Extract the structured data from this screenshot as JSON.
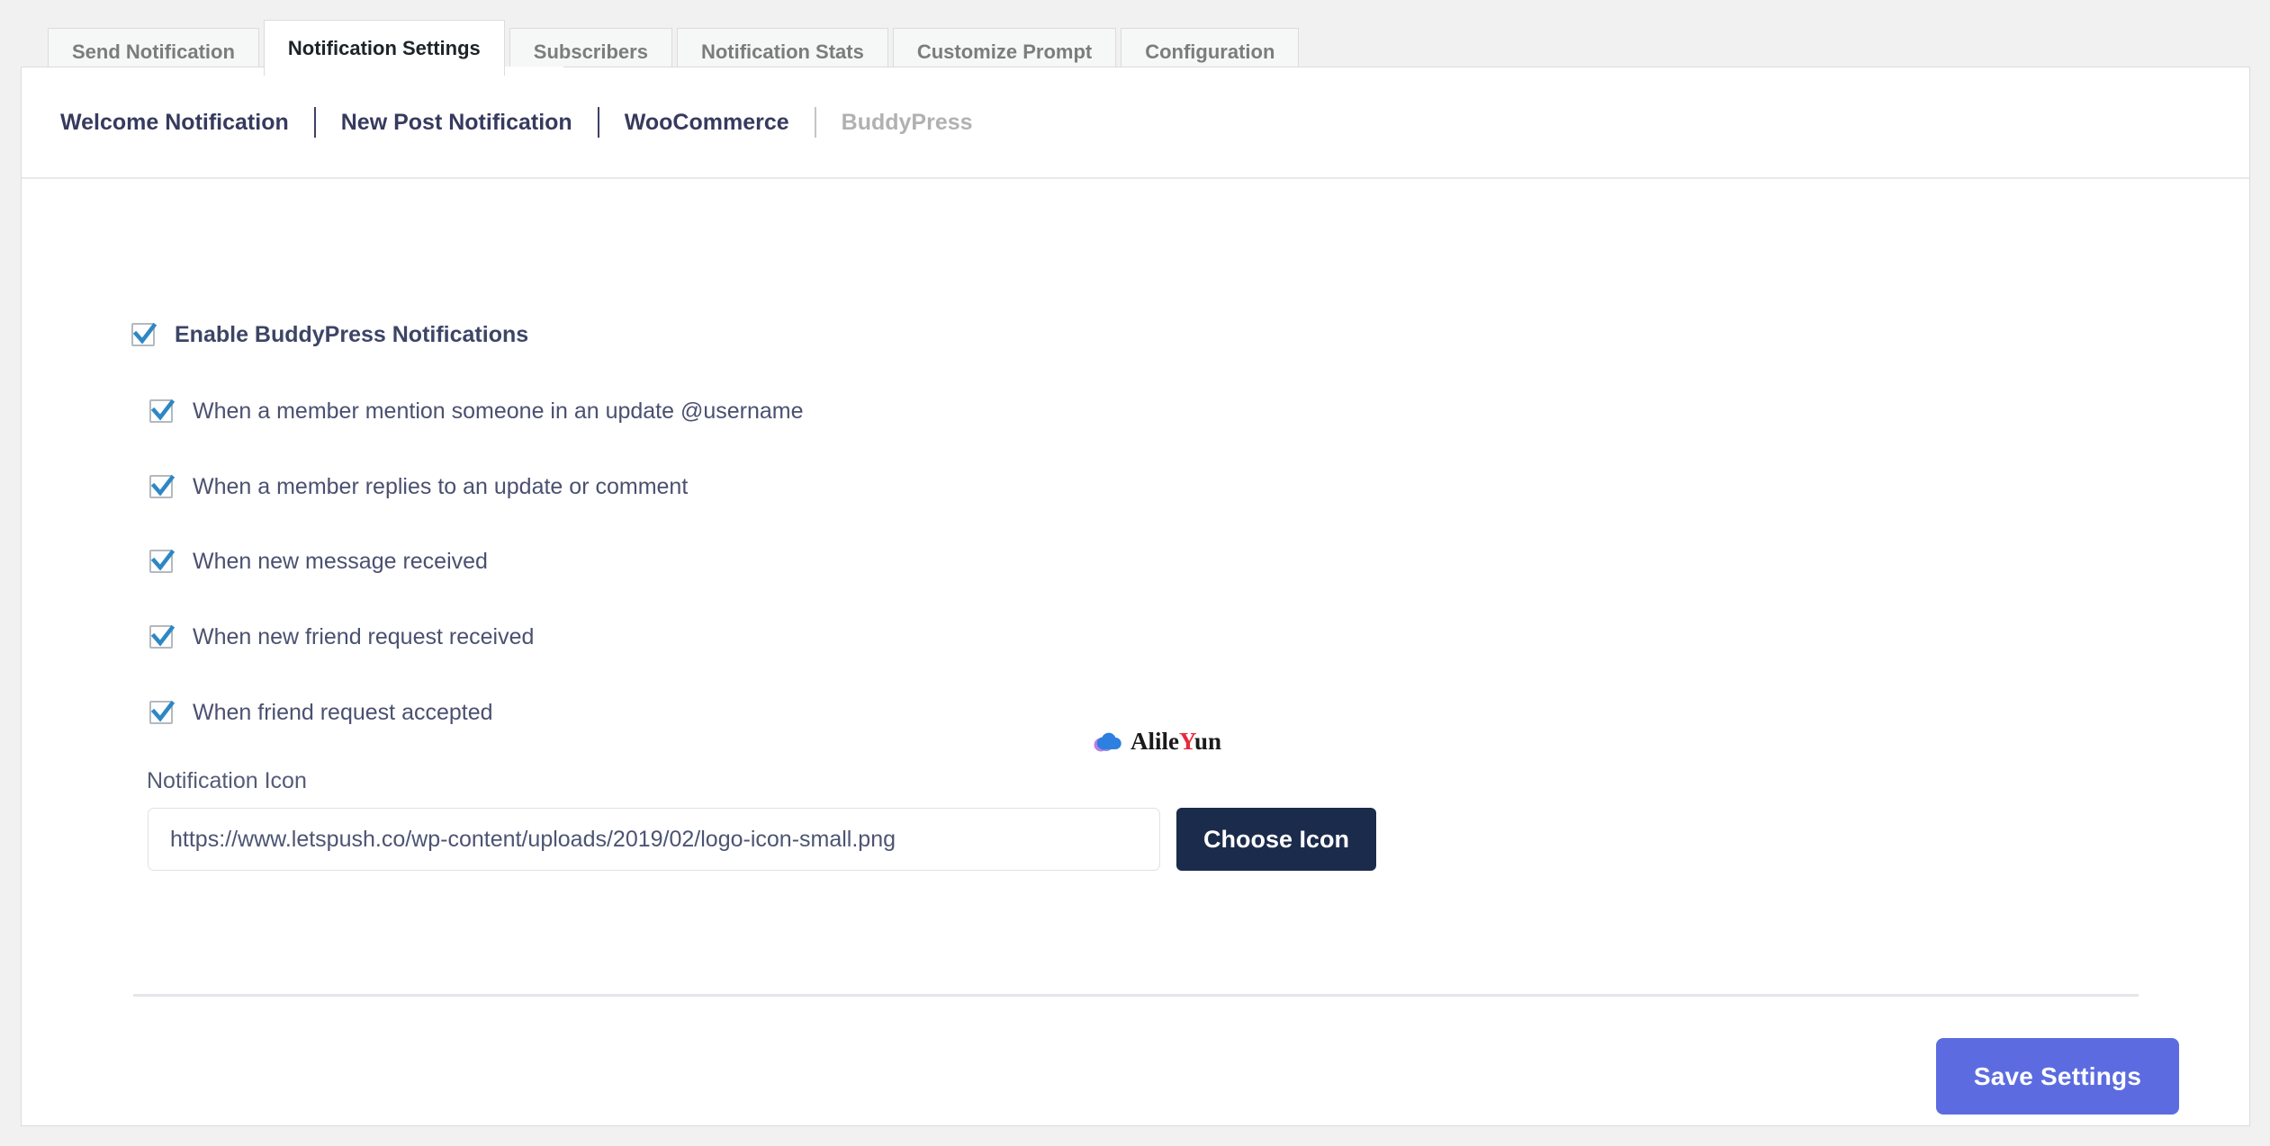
{
  "tabs": [
    {
      "label": "Send Notification",
      "active": false
    },
    {
      "label": "Notification Settings",
      "active": true
    },
    {
      "label": "Subscribers",
      "active": false
    },
    {
      "label": "Notification Stats",
      "active": false
    },
    {
      "label": "Customize Prompt",
      "active": false
    },
    {
      "label": "Configuration",
      "active": false
    }
  ],
  "subnav": [
    {
      "label": "Welcome Notification",
      "current": false
    },
    {
      "label": "New Post Notification",
      "current": false
    },
    {
      "label": "WooCommerce",
      "current": false
    },
    {
      "label": "BuddyPress",
      "current": true
    }
  ],
  "settings": {
    "master": {
      "label": "Enable BuddyPress Notifications",
      "checked": true
    },
    "options": [
      {
        "label": "When a member mention someone in an update @username",
        "checked": true
      },
      {
        "label": "When a member replies to an update or comment",
        "checked": true
      },
      {
        "label": "When new message received",
        "checked": true
      },
      {
        "label": "When new friend request received",
        "checked": true
      },
      {
        "label": "When friend request accepted",
        "checked": true
      }
    ]
  },
  "notification_icon": {
    "label": "Notification Icon",
    "value": "https://www.letspush.co/wp-content/uploads/2019/02/logo-icon-small.png",
    "placeholder": "Notification icon URL",
    "choose_button": "Choose Icon"
  },
  "footer": {
    "save_label": "Save Settings"
  },
  "watermark": {
    "text_part_1": "Alile",
    "text_part_2": "Y",
    "text_part_3": "un",
    "icon": "cloud-icon"
  },
  "colors": {
    "accent_save": "#5c6ce0",
    "choose_button": "#1b2b4b",
    "checkbox_check": "#2e87c4",
    "subnav_link": "#363a5e",
    "subnav_current": "#b1b1b1",
    "watermark_red": "#e8283c",
    "page_background": "#f1f1f1",
    "panel_background": "#ffffff"
  }
}
